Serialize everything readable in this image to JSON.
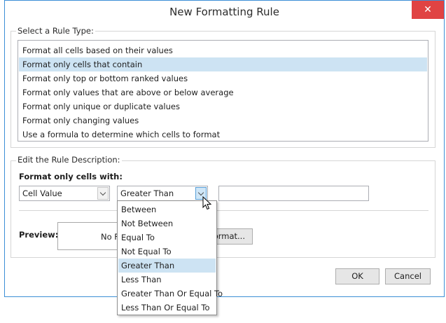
{
  "window": {
    "title": "New Formatting Rule",
    "close_symbol": "✕"
  },
  "rule_type": {
    "legend": "Select a Rule Type:",
    "items": [
      {
        "label": "Format all cells based on their values"
      },
      {
        "label": "Format only cells that contain"
      },
      {
        "label": "Format only top or bottom ranked values"
      },
      {
        "label": "Format only values that are above or below average"
      },
      {
        "label": "Format only unique or duplicate values"
      },
      {
        "label": "Format only changing values"
      },
      {
        "label": "Use a formula to determine which cells to format"
      }
    ],
    "selected_index": 1
  },
  "description": {
    "legend": "Edit the Rule Description:",
    "format_label": "Format only cells with:",
    "condition_type": "Cell Value",
    "operator": "Greater Than",
    "value": "",
    "preview_label": "Preview:",
    "preview_text": "No F",
    "format_button": "Format..."
  },
  "operator_dropdown": {
    "items": [
      {
        "label": "Between"
      },
      {
        "label": "Not Between"
      },
      {
        "label": "Equal To"
      },
      {
        "label": "Not Equal To"
      },
      {
        "label": "Greater Than"
      },
      {
        "label": "Less Than"
      },
      {
        "label": "Greater Than Or Equal To"
      },
      {
        "label": "Less Than Or Equal To"
      }
    ],
    "highlighted_index": 4
  },
  "footer": {
    "ok_label": "OK",
    "cancel_label": "Cancel"
  },
  "colors": {
    "selection": "#cde3f3",
    "close_button": "#e04343",
    "window_border": "#3c8fd6"
  }
}
